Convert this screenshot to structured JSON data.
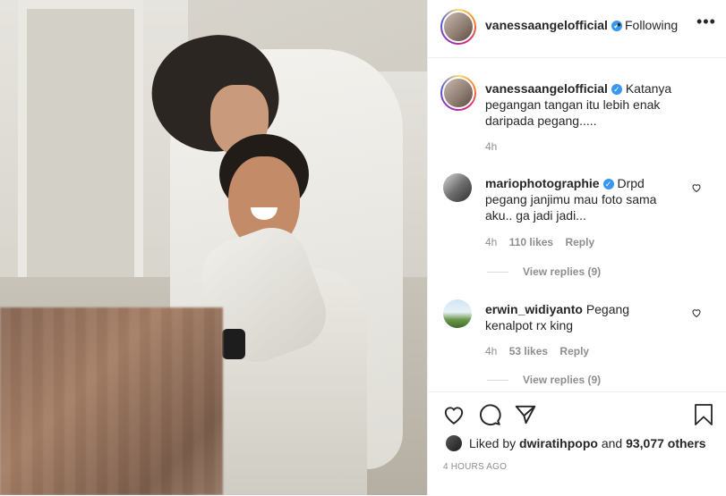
{
  "post_owner": {
    "username": "vanessaangelofficial",
    "verified": true,
    "follow_status": "Following",
    "dot": "•",
    "more": "•••"
  },
  "caption": {
    "username": "vanessaangelofficial",
    "text_lines": [
      "Katanya",
      "pegangan tangan itu lebih enak",
      "daripada pegang....."
    ],
    "time": "4h"
  },
  "comments": [
    {
      "username": "mariophotographie",
      "verified": true,
      "text_lines": [
        "Drpd",
        "pegang janjimu mau foto sama",
        "aku.. ga jadi jadi..."
      ],
      "time": "4h",
      "likes": "110 likes",
      "reply": "Reply",
      "view_replies": "View replies (9)"
    },
    {
      "username": "erwin_widiyanto",
      "verified": false,
      "text_lines": [
        "Pegang",
        "kenalpot rx king"
      ],
      "time": "4h",
      "likes": "53 likes",
      "reply": "Reply",
      "view_replies": "View replies (9)"
    }
  ],
  "likes_summary": {
    "prefix": "Liked by",
    "user": "dwiratihpopo",
    "conjunction": "and",
    "others": "93,077 others"
  },
  "timestamp": "4 HOURS AGO",
  "icons": [
    "heart-icon",
    "comment-icon",
    "share-icon",
    "bookmark-icon",
    "verified-icon",
    "more-options-icon"
  ],
  "colors": {
    "verified": "#3897f0",
    "text": "#262626",
    "muted": "#8e8e8e",
    "border": "#efefef"
  }
}
